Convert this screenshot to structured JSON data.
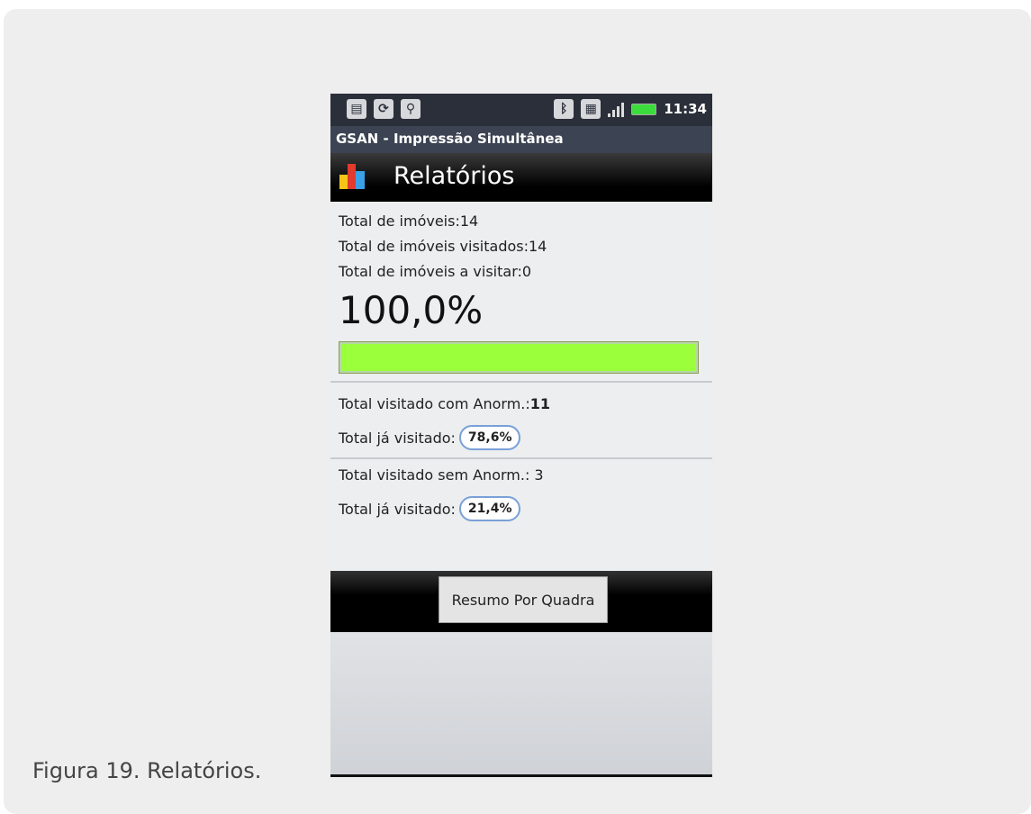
{
  "statusbar": {
    "time": "11:34"
  },
  "app_title": "GSAN - Impressão Simultânea",
  "header": {
    "title": "Relatórios",
    "icon": "bar-chart-icon"
  },
  "stats": {
    "total_imoveis": "Total de imóveis:14",
    "total_visitados": "Total de imóveis visitados:14",
    "total_a_visitar": "Total de imóveis a visitar:0",
    "percent": "100,0%",
    "progress_fraction": 1.0
  },
  "com_anormalidade": {
    "label": "Total visitado com Anorm.: ",
    "value": "11",
    "visited_label": "Total já visitado:",
    "visited_percent": "78,6%"
  },
  "sem_anormalidade": {
    "label": "Total visitado sem Anorm.: 3",
    "visited_label": "Total já visitado:",
    "visited_percent": "21,4%"
  },
  "button": {
    "label": "Resumo Por Quadra"
  },
  "caption": "Figura 19. Relatórios.",
  "colors": {
    "progress": "#9bff3c",
    "header": "#000000"
  }
}
